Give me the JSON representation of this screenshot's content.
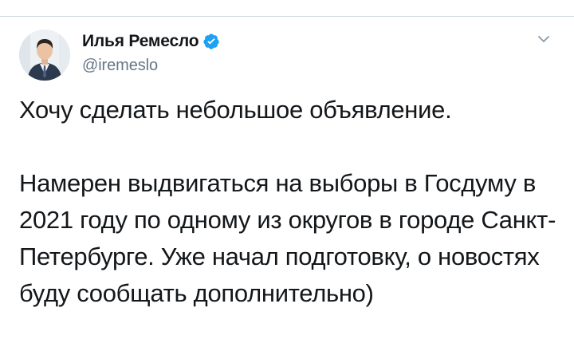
{
  "author": {
    "display_name": "Илья Ремесло",
    "handle": "@iremeslo",
    "verified": true,
    "avatar_icon": "person-in-suit-avatar"
  },
  "tweet": {
    "paragraph_1": "Хочу сделать небольшое объявление.",
    "paragraph_2": "Намерен выдвигаться на выборы в Госдуму в 2021 году по одному из округов в городе Санкт-Петербурге. Уже начал подготовку, о новостях буду сообщать дополнительно)"
  },
  "icons": {
    "verified": "verified-badge-icon",
    "menu": "chevron-down-icon"
  },
  "colors": {
    "text_primary": "#14171a",
    "text_secondary": "#657786",
    "verified_blue": "#1da1f2",
    "divider": "#cfd9de"
  }
}
